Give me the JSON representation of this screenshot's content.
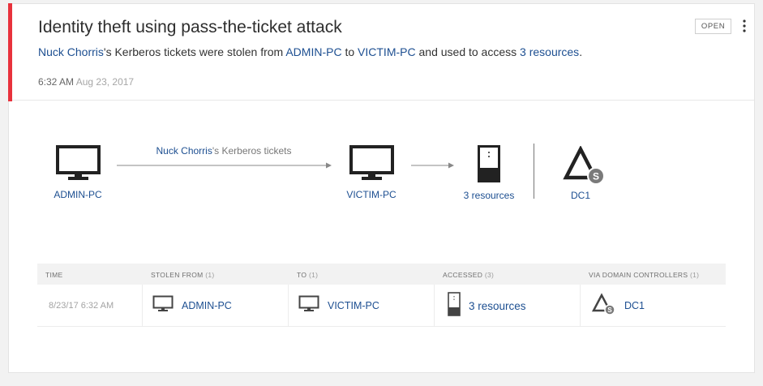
{
  "alert": {
    "title": "Identity theft using pass-the-ticket attack",
    "summary": {
      "user": "Nuck Chorris",
      "text1": "'s Kerberos tickets were stolen from ",
      "source": "ADMIN-PC",
      "text2": " to ",
      "destination": "VICTIM-PC",
      "text3": " and used to access ",
      "resources": "3 resources",
      "text4": "."
    },
    "time": "6:32 AM",
    "date": "Aug 23, 2017",
    "status_button": "OPEN",
    "accent_color": "#e8323c",
    "link_color": "#1d4f91"
  },
  "diagram": {
    "source_node": {
      "label": "ADMIN-PC",
      "icon": "monitor-icon"
    },
    "arrow_label_user": "Nuck Chorris",
    "arrow_label_rest": "'s Kerberos tickets",
    "destination_node": {
      "label": "VICTIM-PC",
      "icon": "monitor-icon"
    },
    "resources_node": {
      "label": "3 resources",
      "icon": "server-icon"
    },
    "dc_node": {
      "label": "DC1",
      "icon": "domain-controller-icon"
    }
  },
  "table": {
    "headers": {
      "time": "TIME",
      "stolen_from": "STOLEN FROM",
      "stolen_from_count": "(1)",
      "to": "TO",
      "to_count": "(1)",
      "accessed": "ACCESSED",
      "accessed_count": "(3)",
      "via_dc": "VIA DOMAIN CONTROLLERS",
      "via_dc_count": "(1)"
    },
    "row": {
      "time": "8/23/17 6:32 AM",
      "stolen_from": "ADMIN-PC",
      "to": "VICTIM-PC",
      "accessed": "3 resources",
      "via_dc": "DC1"
    }
  }
}
